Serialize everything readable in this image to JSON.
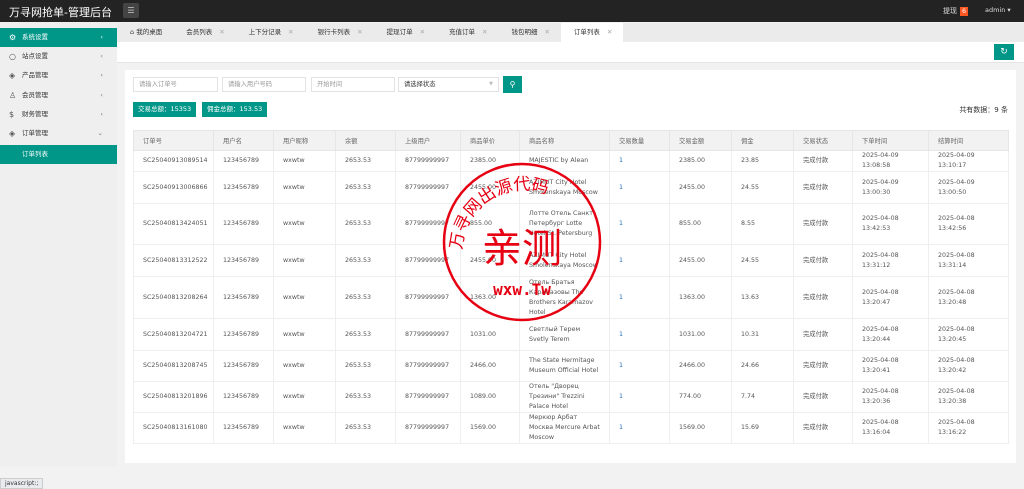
{
  "header": {
    "title": "万寻网抢单-管理后台",
    "withdraw_label": "提现",
    "withdraw_badge": "6",
    "user": "admin ▾"
  },
  "sidebar": {
    "items": [
      {
        "label": "系统设置",
        "icon": "gear-icon"
      },
      {
        "label": "站点设置",
        "icon": "site-icon"
      },
      {
        "label": "产品管理",
        "icon": "cube-icon"
      },
      {
        "label": "会员管理",
        "icon": "user-icon"
      },
      {
        "label": "财务管理",
        "icon": "dollar-icon"
      },
      {
        "label": "订单管理",
        "icon": "order-icon"
      }
    ],
    "sub_item": "订单列表"
  },
  "tabs": [
    {
      "label": "我的桌面"
    },
    {
      "label": "会员列表"
    },
    {
      "label": "上下分记录"
    },
    {
      "label": "银行卡列表"
    },
    {
      "label": "提现订单"
    },
    {
      "label": "充值订单"
    },
    {
      "label": "钱包明细"
    },
    {
      "label": "订单列表"
    }
  ],
  "filters": {
    "order_placeholder": "请输入订单号",
    "user_placeholder": "请输入用户号码",
    "time_placeholder": "开始时间",
    "status_select": "请选择状态"
  },
  "summary": {
    "trade_total": "交易总额：15353",
    "commission_total": "佣金总额：153.53",
    "record_count": "共有数据：9 条"
  },
  "table": {
    "headers": [
      "订单号",
      "用户名",
      "用户昵称",
      "余额",
      "上级用户",
      "商品单价",
      "商品名称",
      "交易数量",
      "交易金额",
      "佣金",
      "交易状态",
      "下单时间",
      "结算时间"
    ],
    "rows": [
      [
        "SC25040913089514",
        "123456789",
        "wxwtw",
        "2653.53",
        "87799999997",
        "2385.00",
        "MAJESTIC by Alean",
        "1",
        "2385.00",
        "23.85",
        "完成付款",
        "2025-04-09 13:08:58",
        "2025-04-09 13:10:17"
      ],
      [
        "SC25040913006866",
        "123456789",
        "wxwtw",
        "2653.53",
        "87799999997",
        "2455.00",
        "AZIMUT City Hotel Smolenskaya Moscow",
        "1",
        "2455.00",
        "24.55",
        "完成付款",
        "2025-04-09 13:00:30",
        "2025-04-09 13:00:50"
      ],
      [
        "SC25040813424051",
        "123456789",
        "wxwtw",
        "2653.53",
        "87799999997",
        "855.00",
        "Лотте Отель Санкт-Петербург Lotte Hotel St. Petersburg",
        "1",
        "855.00",
        "8.55",
        "完成付款",
        "2025-04-08 13:42:53",
        "2025-04-08 13:42:56"
      ],
      [
        "SC25040813312522",
        "123456789",
        "wxwtw",
        "2653.53",
        "87799999997",
        "2455.00",
        "AZIMUT City Hotel Smolenskaya Moscow",
        "1",
        "2455.00",
        "24.55",
        "完成付款",
        "2025-04-08 13:31:12",
        "2025-04-08 13:31:14"
      ],
      [
        "SC25040813208264",
        "123456789",
        "wxwtw",
        "2653.53",
        "87799999997",
        "1363.00",
        "Отель Братья Карамазовы The Brothers Karamazov Hotel",
        "1",
        "1363.00",
        "13.63",
        "完成付款",
        "2025-04-08 13:20:47",
        "2025-04-08 13:20:48"
      ],
      [
        "SC25040813204721",
        "123456789",
        "wxwtw",
        "2653.53",
        "87799999997",
        "1031.00",
        "Светлый Терем Svetly Terem",
        "1",
        "1031.00",
        "10.31",
        "完成付款",
        "2025-04-08 13:20:44",
        "2025-04-08 13:20:45"
      ],
      [
        "SC25040813208745",
        "123456789",
        "wxwtw",
        "2653.53",
        "87799999997",
        "2466.00",
        "The State Hermitage Museum Official Hotel",
        "1",
        "2466.00",
        "24.66",
        "完成付款",
        "2025-04-08 13:20:41",
        "2025-04-08 13:20:42"
      ],
      [
        "SC25040813201896",
        "123456789",
        "wxwtw",
        "2653.53",
        "87799999997",
        "1089.00",
        "Отель \"Дворец Трезини\" Trezzini Palace Hotel",
        "1",
        "774.00",
        "7.74",
        "完成付款",
        "2025-04-08 13:20:36",
        "2025-04-08 13:20:38"
      ],
      [
        "SC25040813161080",
        "123456789",
        "wxwtw",
        "2653.53",
        "87799999997",
        "1569.00",
        "Меркюр Арбат Москва Mercure Arbat Moscow",
        "1",
        "1569.00",
        "15.69",
        "完成付款",
        "2025-04-08 13:16:04",
        "2025-04-08 13:16:22"
      ]
    ]
  },
  "stamp": {
    "arc_text": "万寻网出源代码",
    "main": "亲测",
    "url": "wxw.Tw"
  },
  "statusbar": "javascript:;",
  "colors": {
    "accent": "#009688",
    "topbar": "#232323",
    "badge": "#ff5722",
    "stamp": "#e60012"
  }
}
